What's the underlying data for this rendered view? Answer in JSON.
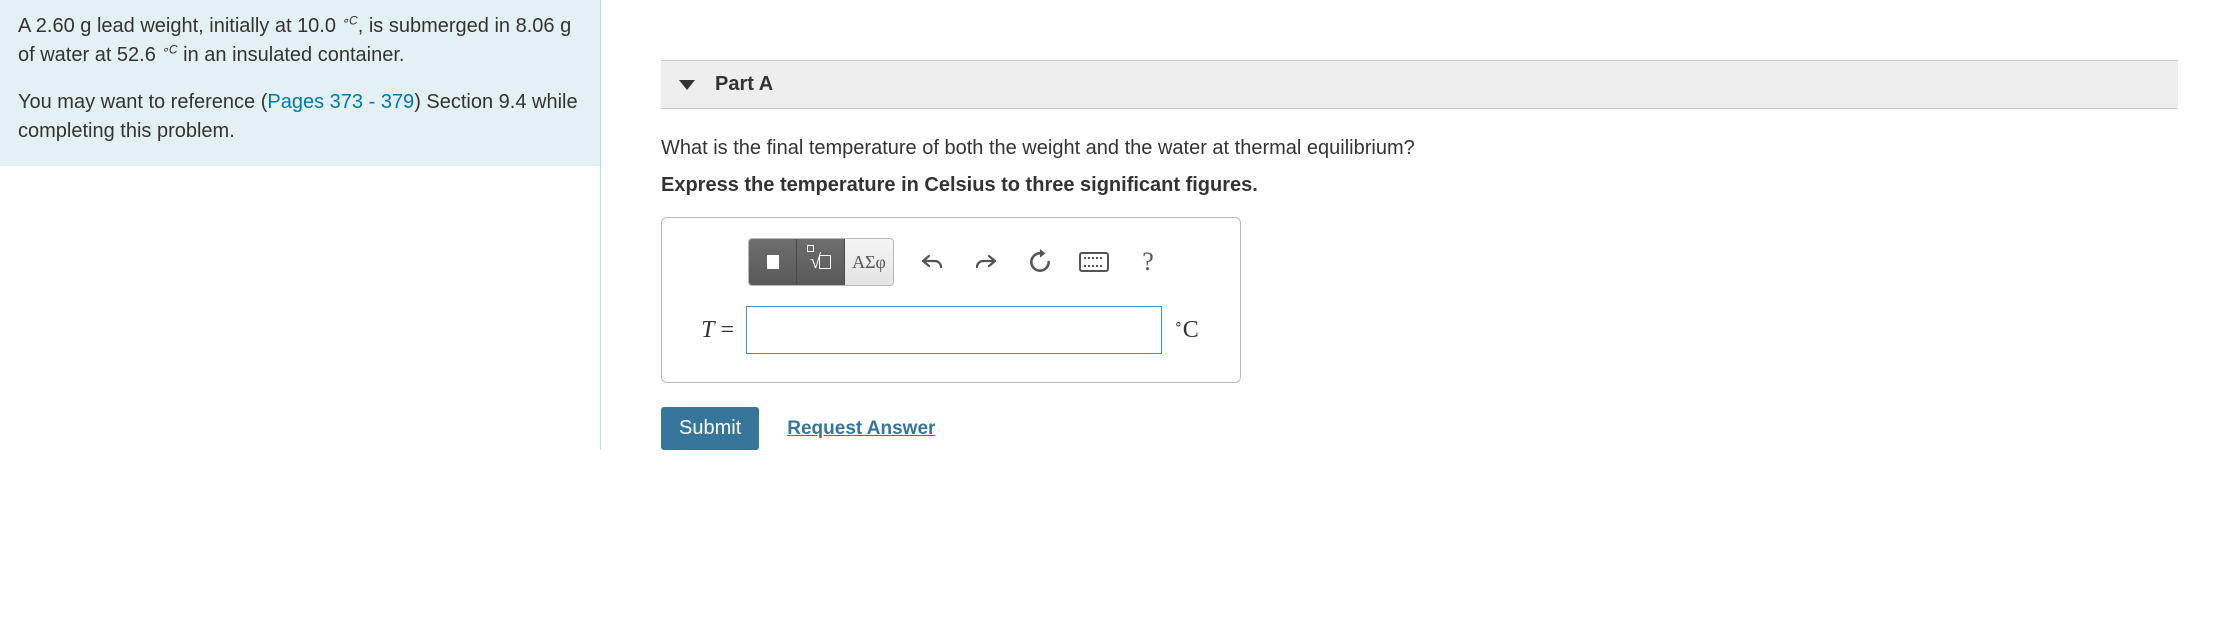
{
  "problem": {
    "p1_a": "A 2.60 g lead weight, initially at 10.0 ",
    "p1_deg1": "∘C",
    "p1_b": ", is submerged in 8.06 g of water at 52.6 ",
    "p1_deg2": "∘C",
    "p1_c": " in an insulated container.",
    "p2_a": "You may want to reference (",
    "pages_link": "Pages 373 - 379",
    "p2_b": ") Section 9.4 while completing this problem."
  },
  "part": {
    "label": "Part A",
    "question": "What is the final temperature of both the weight and the water at thermal equilibrium?",
    "instruction": "Express the temperature in Celsius to three significant figures.",
    "toolbar": {
      "greek": "ΑΣφ",
      "help": "?"
    },
    "answer": {
      "var": "T",
      "eq": " =",
      "value": "",
      "unit_deg": "∘",
      "unit_c": "C"
    },
    "actions": {
      "submit": "Submit",
      "request": "Request Answer"
    }
  }
}
